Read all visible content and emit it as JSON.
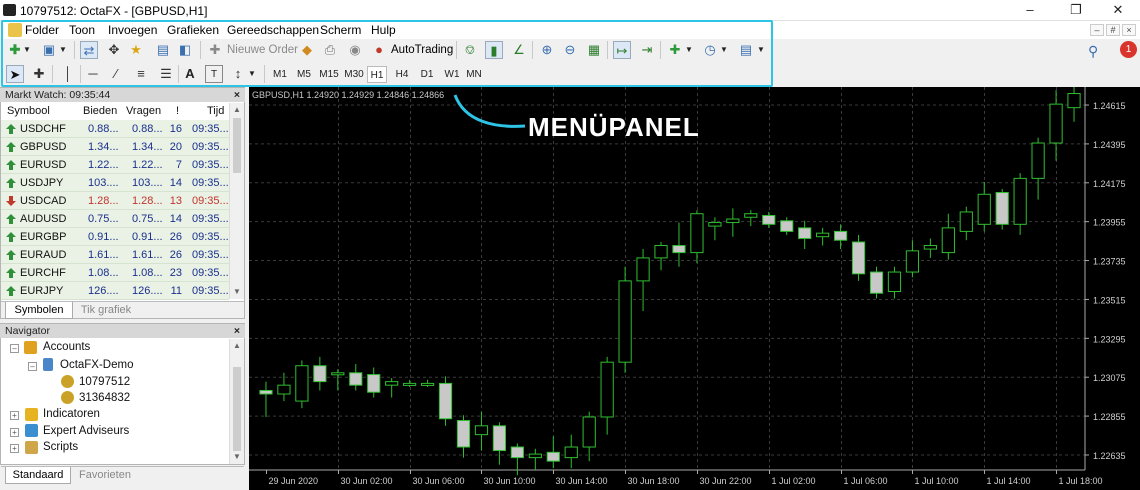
{
  "window": {
    "title": "10797512: OctaFX - [GBPUSD,H1]"
  },
  "menu": [
    "Folder",
    "Toon",
    "Invoegen",
    "Grafieken",
    "Gereedschappen",
    "Scherm",
    "Hulp"
  ],
  "toolbar": {
    "new_order": "Nieuwe Order",
    "autotrading": "AutoTrading"
  },
  "timeframes": [
    "M1",
    "M5",
    "M15",
    "M30",
    "H1",
    "H4",
    "D1",
    "W1",
    "MN"
  ],
  "active_timeframe": "H1",
  "callout": "MENÜPANEL",
  "notification_count": "1",
  "market_watch": {
    "title": "Markt Watch: 09:35:44",
    "columns": [
      "Symbool",
      "Bieden",
      "Vragen",
      "!",
      "Tijd"
    ],
    "rows": [
      {
        "symbol": "USDCHF",
        "bid": "0.88...",
        "ask": "0.88...",
        "spread": "16",
        "time": "09:35...",
        "dir": "up"
      },
      {
        "symbol": "GBPUSD",
        "bid": "1.34...",
        "ask": "1.34...",
        "spread": "20",
        "time": "09:35...",
        "dir": "up"
      },
      {
        "symbol": "EURUSD",
        "bid": "1.22...",
        "ask": "1.22...",
        "spread": "7",
        "time": "09:35...",
        "dir": "up"
      },
      {
        "symbol": "USDJPY",
        "bid": "103....",
        "ask": "103....",
        "spread": "14",
        "time": "09:35...",
        "dir": "up"
      },
      {
        "symbol": "USDCAD",
        "bid": "1.28...",
        "ask": "1.28...",
        "spread": "13",
        "time": "09:35...",
        "dir": "down"
      },
      {
        "symbol": "AUDUSD",
        "bid": "0.75...",
        "ask": "0.75...",
        "spread": "14",
        "time": "09:35...",
        "dir": "up"
      },
      {
        "symbol": "EURGBP",
        "bid": "0.91...",
        "ask": "0.91...",
        "spread": "26",
        "time": "09:35...",
        "dir": "up"
      },
      {
        "symbol": "EURAUD",
        "bid": "1.61...",
        "ask": "1.61...",
        "spread": "26",
        "time": "09:35...",
        "dir": "up"
      },
      {
        "symbol": "EURCHF",
        "bid": "1.08...",
        "ask": "1.08...",
        "spread": "23",
        "time": "09:35...",
        "dir": "up"
      },
      {
        "symbol": "EURJPY",
        "bid": "126....",
        "ask": "126....",
        "spread": "11",
        "time": "09:35...",
        "dir": "up"
      }
    ],
    "tabs": [
      "Symbolen",
      "Tik grafiek"
    ]
  },
  "navigator": {
    "title": "Navigator",
    "accounts_label": "Accounts",
    "broker": "OctaFX-Demo",
    "accounts": [
      "10797512",
      "31364832"
    ],
    "indicators": "Indicatoren",
    "experts": "Expert Adviseurs",
    "scripts": "Scripts",
    "tabs": [
      "Standaard",
      "Favorieten"
    ]
  },
  "chart_header": "GBPUSD,H1  1.24920 1.24929 1.24846 1.24866",
  "chart_data": {
    "type": "candlestick",
    "symbol": "GBPUSD",
    "timeframe": "H1",
    "y_ticks": [
      "1.24615",
      "1.24395",
      "1.24175",
      "1.23955",
      "1.23735",
      "1.23515",
      "1.23295",
      "1.23075",
      "1.22855",
      "1.22635"
    ],
    "ylim": [
      1.2255,
      1.247
    ],
    "x_ticks": [
      "29 Jun 2020",
      "30 Jun 02:00",
      "30 Jun 06:00",
      "30 Jun 10:00",
      "30 Jun 14:00",
      "30 Jun 18:00",
      "30 Jun 22:00",
      "1 Jul 02:00",
      "1 Jul 06:00",
      "1 Jul 10:00",
      "1 Jul 14:00",
      "1 Jul 18:00"
    ],
    "candles": [
      [
        1.23,
        1.2305,
        1.2285,
        1.2298
      ],
      [
        1.2298,
        1.231,
        1.2294,
        1.2303
      ],
      [
        1.2294,
        1.2317,
        1.229,
        1.2314
      ],
      [
        1.2314,
        1.2319,
        1.23,
        1.2305
      ],
      [
        1.231,
        1.2312,
        1.23,
        1.231
      ],
      [
        1.231,
        1.2315,
        1.23,
        1.2303
      ],
      [
        1.2309,
        1.2313,
        1.2296,
        1.2299
      ],
      [
        1.2303,
        1.2307,
        1.2296,
        1.2305
      ],
      [
        1.2304,
        1.2306,
        1.2302,
        1.2304
      ],
      [
        1.2304,
        1.2306,
        1.2302,
        1.2304
      ],
      [
        1.2304,
        1.2308,
        1.228,
        1.2284
      ],
      [
        1.2283,
        1.2286,
        1.2262,
        1.2268
      ],
      [
        1.2275,
        1.2288,
        1.2266,
        1.228
      ],
      [
        1.228,
        1.2282,
        1.2258,
        1.2266
      ],
      [
        1.2268,
        1.227,
        1.2252,
        1.2262
      ],
      [
        1.2262,
        1.2267,
        1.2255,
        1.2264
      ],
      [
        1.2265,
        1.2274,
        1.2256,
        1.226
      ],
      [
        1.2262,
        1.2275,
        1.2256,
        1.2268
      ],
      [
        1.2268,
        1.2288,
        1.226,
        1.2285
      ],
      [
        1.2285,
        1.2319,
        1.2275,
        1.2316
      ],
      [
        1.2316,
        1.237,
        1.231,
        1.2362
      ],
      [
        1.2362,
        1.238,
        1.2345,
        1.2375
      ],
      [
        1.2375,
        1.2384,
        1.2368,
        1.2382
      ],
      [
        1.2382,
        1.2395,
        1.237,
        1.2378
      ],
      [
        1.2378,
        1.2402,
        1.2372,
        1.24
      ],
      [
        1.2393,
        1.2398,
        1.2385,
        1.2395
      ],
      [
        1.2395,
        1.2403,
        1.2387,
        1.2397
      ],
      [
        1.2398,
        1.2402,
        1.2393,
        1.24
      ],
      [
        1.2399,
        1.2401,
        1.2392,
        1.2394
      ],
      [
        1.2396,
        1.2398,
        1.2388,
        1.239
      ],
      [
        1.2392,
        1.2396,
        1.238,
        1.2386
      ],
      [
        1.2387,
        1.2392,
        1.2382,
        1.2389
      ],
      [
        1.239,
        1.2394,
        1.238,
        1.2385
      ],
      [
        1.2384,
        1.2388,
        1.2362,
        1.2366
      ],
      [
        1.2367,
        1.237,
        1.2352,
        1.2355
      ],
      [
        1.2356,
        1.237,
        1.2352,
        1.2367
      ],
      [
        1.2367,
        1.2385,
        1.2364,
        1.2379
      ],
      [
        1.238,
        1.2386,
        1.2375,
        1.2382
      ],
      [
        1.2378,
        1.24,
        1.2374,
        1.2392
      ],
      [
        1.239,
        1.2404,
        1.2385,
        1.2401
      ],
      [
        1.2394,
        1.2418,
        1.239,
        1.2411
      ],
      [
        1.2412,
        1.2414,
        1.2391,
        1.2394
      ],
      [
        1.2394,
        1.2423,
        1.2388,
        1.242
      ],
      [
        1.242,
        1.2443,
        1.2408,
        1.244
      ],
      [
        1.244,
        1.247,
        1.243,
        1.2462
      ],
      [
        1.246,
        1.2472,
        1.2452,
        1.2468
      ]
    ]
  }
}
